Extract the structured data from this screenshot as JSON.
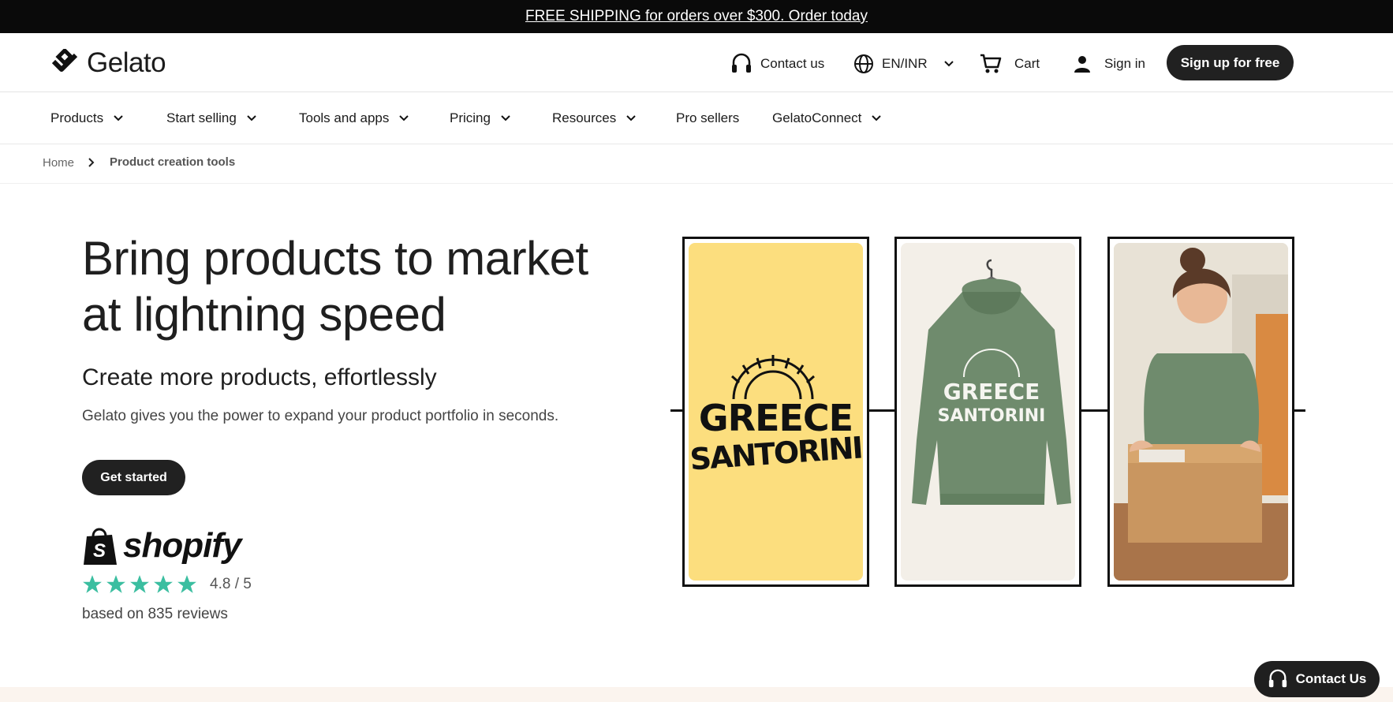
{
  "promo": {
    "text": "FREE SHIPPING for orders over $300. Order today"
  },
  "header": {
    "logo_text": "Gelato",
    "contact_label": "Contact us",
    "locale_label": "EN/INR",
    "cart_label": "Cart",
    "signin_label": "Sign in",
    "signup_label": "Sign up for free"
  },
  "nav": {
    "items": [
      {
        "label": "Products",
        "has_dropdown": true
      },
      {
        "label": "Start selling",
        "has_dropdown": true
      },
      {
        "label": "Tools and apps",
        "has_dropdown": true
      },
      {
        "label": "Pricing",
        "has_dropdown": true
      },
      {
        "label": "Resources",
        "has_dropdown": true
      },
      {
        "label": "Pro sellers",
        "has_dropdown": false
      },
      {
        "label": "GelatoConnect",
        "has_dropdown": true
      }
    ]
  },
  "breadcrumb": {
    "home": "Home",
    "current": "Product creation tools"
  },
  "hero": {
    "title_line1": "Bring products to market",
    "title_line2": "at lightning speed",
    "subtitle": "Create more products, effortlessly",
    "description": "Gelato gives you the power to expand your product portfolio in seconds.",
    "cta_label": "Get started"
  },
  "rating": {
    "platform": "shopify",
    "stars": 5,
    "score_text": "4.8 / 5",
    "reviews_text": "based on 835 reviews"
  },
  "gallery": {
    "design_text_line1": "GREECE",
    "design_text_line2": "SANTORINI",
    "panel_colors": {
      "design": "#FCDE7E",
      "hoodie_bg": "#F3EFE8",
      "hoodie": "#6F8B6D"
    }
  },
  "floating": {
    "contact_label": "Contact Us"
  },
  "colors": {
    "dark": "#212121",
    "star": "#3BBEA0",
    "band": "#FBF4EE"
  }
}
